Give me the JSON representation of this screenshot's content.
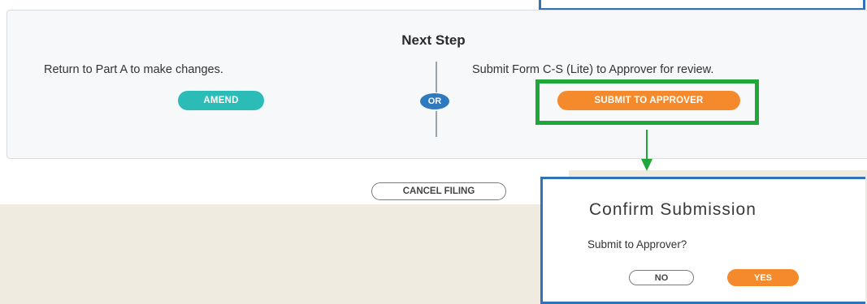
{
  "next_step": {
    "title": "Next Step",
    "left_description": "Return to Part A to make changes.",
    "right_description": "Submit Form C-S (Lite) to Approver for review.",
    "amend_label": "AMEND",
    "or_label": "OR",
    "submit_label": "SUBMIT TO APPROVER"
  },
  "footer": {
    "cancel_label": "CANCEL FILING"
  },
  "confirm_dialog": {
    "title": "Confirm Submission",
    "question": "Submit to Approver?",
    "no_label": "NO",
    "yes_label": "YES"
  },
  "colors": {
    "amend": "#2bbcb8",
    "submit": "#f58a2c",
    "or_badge": "#2f7abf",
    "highlight": "#1fa739",
    "dialog_border": "#2f74ba"
  },
  "icons": {
    "annotation_arrow": "arrow-down-icon"
  }
}
